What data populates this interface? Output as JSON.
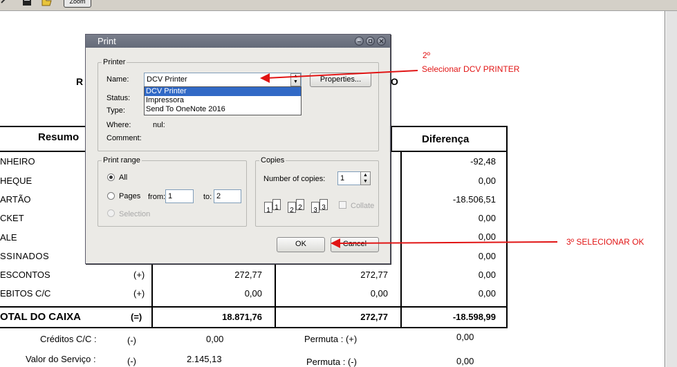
{
  "toolbar": {
    "zoom_label": "Zoom"
  },
  "report": {
    "partial_title_left": "R",
    "partial_title_right": "O",
    "header_left": "Resumo",
    "header_diff": "Diferença",
    "rows": [
      {
        "label": "NHEIRO",
        "sign": "",
        "col1": "",
        "col2": "",
        "diff": "-92,48"
      },
      {
        "label": "HEQUE",
        "sign": "",
        "col1": "",
        "col2": "",
        "diff": "0,00"
      },
      {
        "label": "ARTÃO",
        "sign": "",
        "col1": "",
        "col2": "",
        "diff": "-18.506,51"
      },
      {
        "label": "CKET",
        "sign": "",
        "col1": "",
        "col2": "",
        "diff": "0,00"
      },
      {
        "label": "ALE",
        "sign": "",
        "col1": "",
        "col2": "",
        "diff": "0,00"
      },
      {
        "label": "SSINADOS",
        "sign": "",
        "col1": "",
        "col2": "",
        "diff": "0,00"
      },
      {
        "label": "ESCONTOS",
        "sign": "(+)",
        "col1": "272,77",
        "col2": "272,77",
        "diff": "0,00"
      },
      {
        "label": "EBITOS C/C",
        "sign": "(+)",
        "col1": "0,00",
        "col2": "0,00",
        "diff": "0,00"
      }
    ],
    "total": {
      "label": "OTAL DO CAIXA",
      "sign": "(=)",
      "col1": "18.871,76",
      "col2": "272,77",
      "diff": "-18.598,99"
    },
    "footer": [
      {
        "label": "Créditos C/C  :",
        "sign": "(-)",
        "value": "0,00",
        "right_label": "Permuta : (+)",
        "right_value": "0,00"
      },
      {
        "label": "Valor do Serviço  :",
        "sign": "(-)",
        "value": "2.145,13",
        "right_label": "Permuta : (-)",
        "right_value": "0,00"
      }
    ]
  },
  "dialog": {
    "title": "Print",
    "printer_group": "Printer",
    "name_label": "Name:",
    "name_value": "DCV Printer",
    "status_label": "Status:",
    "type_label": "Type:",
    "where_label": "Where:",
    "where_value": "nul:",
    "comment_label": "Comment:",
    "properties_button": "Properties...",
    "printer_options": [
      "DCV Printer",
      "Impressora",
      "Send To OneNote 2016"
    ],
    "print_range_group": "Print range",
    "range_all": "All",
    "range_pages": "Pages",
    "from_label": "from:",
    "from_value": "1",
    "to_label": "to:",
    "to_value": "2",
    "range_selection": "Selection",
    "copies_group": "Copies",
    "copies_label": "Number of copies:",
    "copies_value": "1",
    "collate_label": "Collate",
    "collate_icons": [
      "1",
      "1",
      "2",
      "2",
      "3",
      "3"
    ],
    "ok_button": "OK",
    "cancel_button": "Cancel"
  },
  "annotations": {
    "step2_number": "2º",
    "step2_text": "Selecionar DCV PRINTER",
    "step3_text": "3º SELECIONAR OK"
  }
}
